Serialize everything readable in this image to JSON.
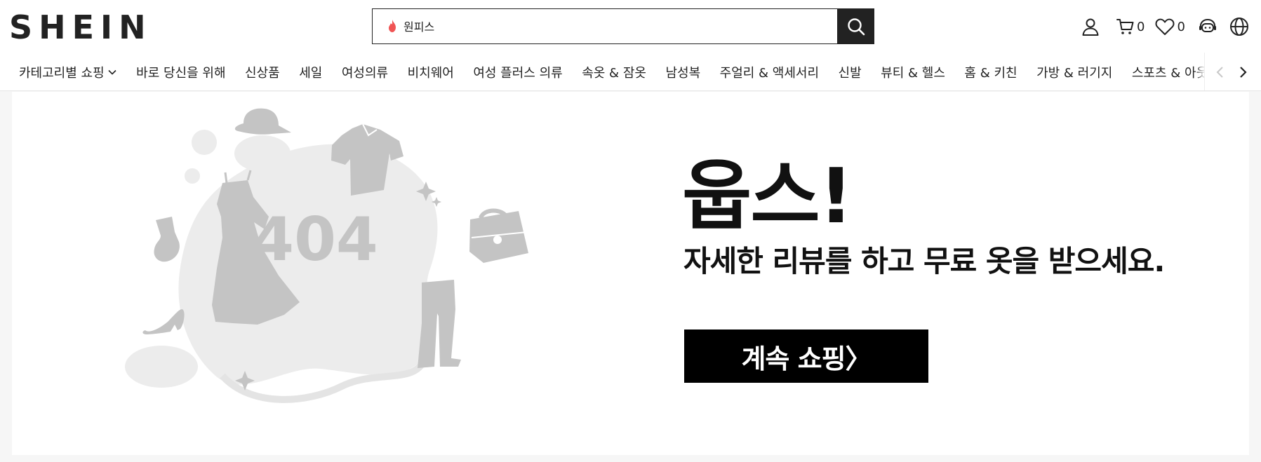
{
  "header": {
    "logo": "SHEIN",
    "search": {
      "value": "원피스"
    },
    "cart_count": "0",
    "wishlist_count": "0"
  },
  "nav": {
    "items": [
      "카테고리별 쇼핑",
      "바로 당신을 위해",
      "신상품",
      "세일",
      "여성의류",
      "비치웨어",
      "여성 플러스 의류",
      "속옷 & 잠옷",
      "남성복",
      "주얼리 & 액세서리",
      "신발",
      "뷰티 & 헬스",
      "홈 & 키친",
      "가방 & 러기지",
      "스포츠 & 아웃도어"
    ]
  },
  "error": {
    "code": "404",
    "title": "웁스!",
    "message": "자세한 리뷰를 하고 무료 옷을 받으세요.",
    "cta": "계속 쇼핑〉"
  },
  "colors": {
    "brand": "#222222",
    "illustration": "#c4c4c4",
    "blob": "#ececec",
    "flame": "#f05454"
  }
}
